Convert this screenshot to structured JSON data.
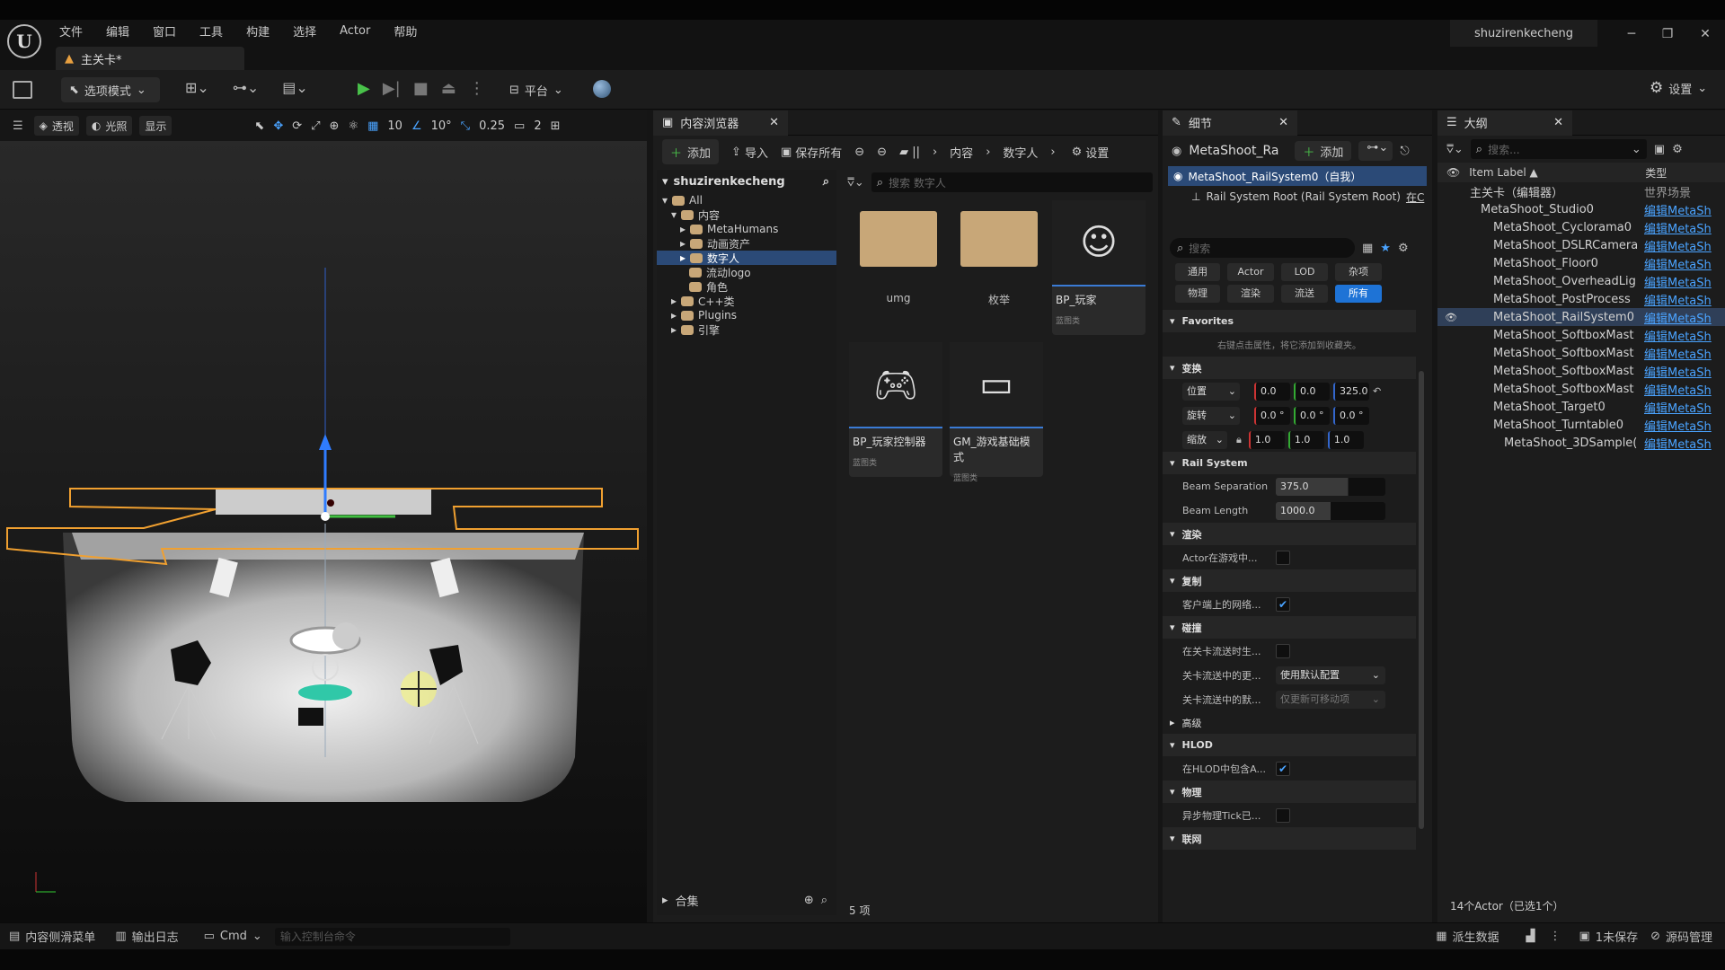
{
  "menu": [
    "文件",
    "编辑",
    "窗口",
    "工具",
    "构建",
    "选择",
    "Actor",
    "帮助"
  ],
  "map_tab": "主关卡*",
  "user": "shuzirenkecheng",
  "toolbar": {
    "mode": "选项模式",
    "platform": "平台",
    "settings": "设置"
  },
  "viewport": {
    "perspective": "透视",
    "lit": "光照",
    "show": "显示",
    "grid": "10",
    "angle": "10°",
    "scale": "0.25",
    "cam": "2"
  },
  "cb": {
    "title": "内容浏览器",
    "add": "添加",
    "import": "导入",
    "save_all": "保存所有",
    "crumbs": [
      "内容",
      "数字人"
    ],
    "settings": "设置",
    "root": "shuzirenkecheng",
    "search": "搜索 数字人",
    "tree": [
      "All",
      "内容",
      "MetaHumans",
      "动画资产",
      "数字人",
      "流动logo",
      "角色",
      "C++类",
      "Plugins",
      "引擎"
    ],
    "assets": [
      {
        "name": "umg",
        "sub": ""
      },
      {
        "name": "枚举",
        "sub": ""
      },
      {
        "name": "BP_玩家",
        "sub": "蓝图类"
      },
      {
        "name": "BP_玩家控制器",
        "sub": "蓝图类"
      },
      {
        "name": "GM_游戏基础模式",
        "sub": "蓝图类"
      }
    ],
    "collections": "合集",
    "count": "5 项"
  },
  "details": {
    "title": "细节",
    "actor": "MetaShoot_Ra",
    "add": "添加",
    "selected": "MetaShoot_RailSystem0（自我）",
    "root": "Rail System Root (Rail System Root)",
    "root_link": "在C",
    "search": "搜索",
    "filters1": [
      "通用",
      "Actor",
      "LOD",
      "杂项"
    ],
    "filters2": [
      "物理",
      "渲染",
      "流送",
      "所有"
    ],
    "favorites": "Favorites",
    "fav_hint": "右键点击属性，将它添加到收藏夹。",
    "transform": "变换",
    "location": "位置",
    "loc": [
      "0.0",
      "0.0",
      "325.0"
    ],
    "rotation": "旋转",
    "rot": [
      "0.0 °",
      "0.0 °",
      "0.0 °"
    ],
    "scale": "缩放",
    "scl": [
      "1.0",
      "1.0",
      "1.0"
    ],
    "rail": "Rail System",
    "sep_label": "Beam Separation",
    "sep": "375.0",
    "len_label": "Beam Length",
    "len": "1000.0",
    "render": "渲染",
    "hidden_label": "Actor在游戏中...",
    "replication": "复制",
    "net_label": "客户端上的网络...",
    "collision": "碰撞",
    "col1": "在关卡流送时生...",
    "col2": "关卡流送中的更...",
    "col2_val": "使用默认配置",
    "col3": "关卡流送中的默...",
    "col3_val": "仅更新可移动项",
    "advanced": "高级",
    "hlod": "HLOD",
    "hlod_label": "在HLOD中包含A...",
    "physics": "物理",
    "phys_label": "异步物理Tick已...",
    "network": "联网"
  },
  "outliner": {
    "title": "大纲",
    "search": "搜索...",
    "label_col": "Item Label ▲",
    "type_col": "类型",
    "rows": [
      {
        "name": "主关卡（编辑器）",
        "type": "世界场景"
      },
      {
        "name": "MetaShoot_Studio0",
        "type": "编辑MetaSh"
      },
      {
        "name": "MetaShoot_Cyclorama0",
        "type": "编辑MetaSh"
      },
      {
        "name": "MetaShoot_DSLRCamera",
        "type": "编辑MetaSh"
      },
      {
        "name": "MetaShoot_Floor0",
        "type": "编辑MetaSh"
      },
      {
        "name": "MetaShoot_OverheadLig",
        "type": "编辑MetaSh"
      },
      {
        "name": "MetaShoot_PostProcess",
        "type": "编辑MetaSh"
      },
      {
        "name": "MetaShoot_RailSystem0",
        "type": "编辑MetaSh"
      },
      {
        "name": "MetaShoot_SoftboxMast",
        "type": "编辑MetaSh"
      },
      {
        "name": "MetaShoot_SoftboxMast",
        "type": "编辑MetaSh"
      },
      {
        "name": "MetaShoot_SoftboxMast",
        "type": "编辑MetaSh"
      },
      {
        "name": "MetaShoot_SoftboxMast",
        "type": "编辑MetaSh"
      },
      {
        "name": "MetaShoot_Target0",
        "type": "编辑MetaSh"
      },
      {
        "name": "MetaShoot_Turntable0",
        "type": "编辑MetaSh"
      },
      {
        "name": "MetaShoot_3DSample(",
        "type": "编辑MetaSh"
      }
    ],
    "footer": "14个Actor（已选1个）"
  },
  "status": {
    "drawer": "内容侧滑菜单",
    "log": "输出日志",
    "cmd": "Cmd",
    "cmd_ph": "输入控制台命令",
    "derived": "派生数据",
    "unsaved": "1未保存",
    "source": "源码管理"
  }
}
